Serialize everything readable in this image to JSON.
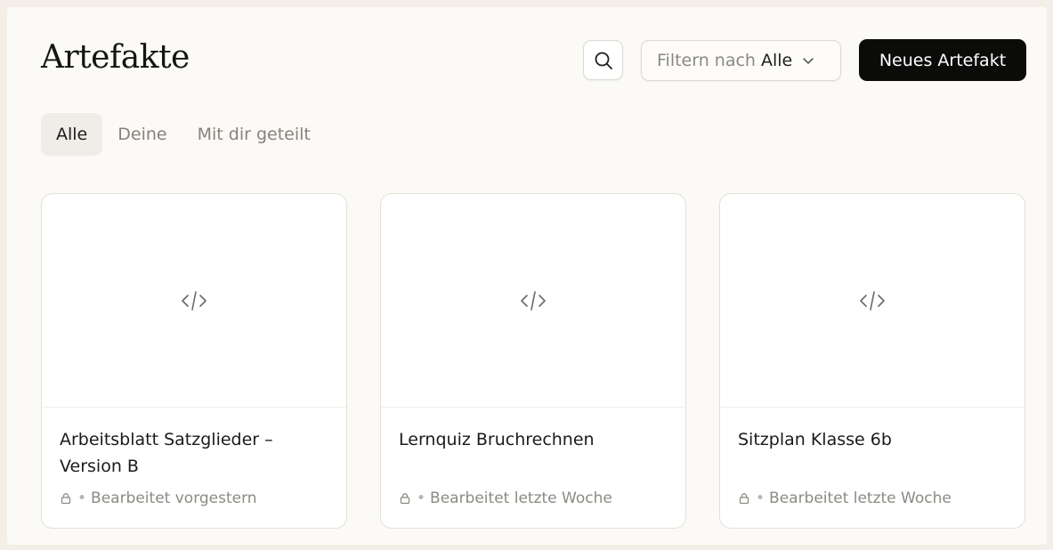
{
  "header": {
    "title": "Artefakte",
    "filter_prefix": "Filtern nach",
    "filter_value": "Alle",
    "new_button_label": "Neues Artefakt"
  },
  "tabs": [
    {
      "label": "Alle",
      "active": true
    },
    {
      "label": "Deine",
      "active": false
    },
    {
      "label": "Mit dir geteilt",
      "active": false
    }
  ],
  "cards": [
    {
      "title": "Arbeitsblatt Satzglieder – Version B",
      "meta": "Bearbeitet vorgestern",
      "icon": "code-icon",
      "visibility_icon": "lock-icon"
    },
    {
      "title": "Lernquiz Bruchrechnen",
      "meta": "Bearbeitet letzte Woche",
      "icon": "code-icon",
      "visibility_icon": "lock-icon"
    },
    {
      "title": "Sitzplan Klasse 6b",
      "meta": "Bearbeitet letzte Woche",
      "icon": "code-icon",
      "visibility_icon": "lock-icon"
    }
  ],
  "icons": {
    "search": "search-icon",
    "filter_chevron": "chevron-down-icon"
  },
  "colors": {
    "page_background": "#fbfaf6",
    "primary_button": "#0b0b0a",
    "active_tab": "#efede7",
    "muted_text": "#8d8a84"
  }
}
